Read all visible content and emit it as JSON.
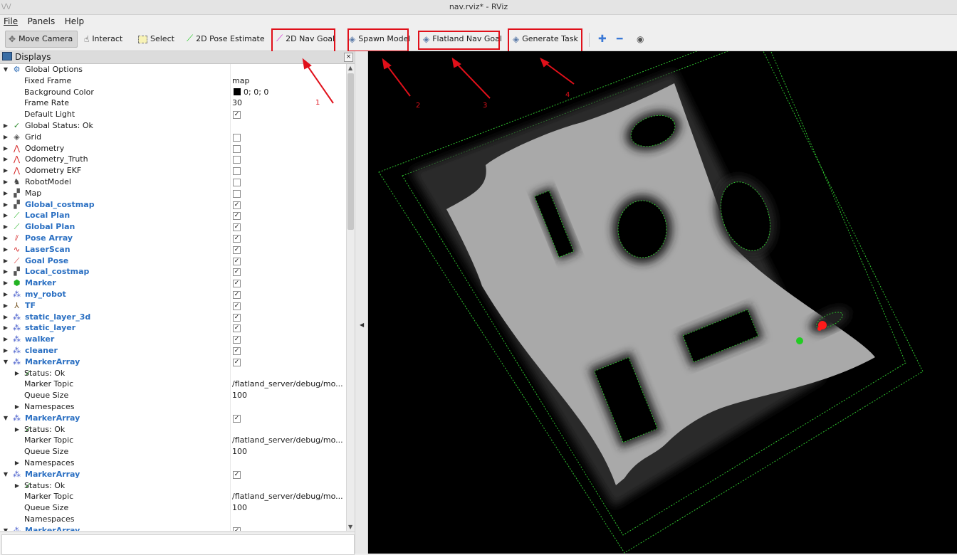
{
  "window": {
    "title": "nav.rviz* - RViz",
    "app_glyph": "\\/\\/"
  },
  "menu": {
    "items": [
      "File",
      "Panels",
      "Help"
    ]
  },
  "toolbar": {
    "move_camera": "Move Camera",
    "interact": "Interact",
    "select": "Select",
    "pose_estimate": "2D Pose Estimate",
    "nav_goal": "2D Nav Goal",
    "spawn_model": "Spawn Model",
    "flatland_nav_goal": "Flatland Nav Goal",
    "generate_task": "Generate Task"
  },
  "annotations": {
    "labels": [
      "1",
      "2",
      "3",
      "4"
    ],
    "color": "#e0101a"
  },
  "displays": {
    "title": "Displays",
    "rows": [
      {
        "indent": 0,
        "arrow": "down",
        "icon": "gear-icon",
        "name": "Global Options",
        "bold": false,
        "value": ""
      },
      {
        "indent": 1,
        "arrow": "",
        "icon": "",
        "name": "Fixed Frame",
        "bold": false,
        "value": "map"
      },
      {
        "indent": 1,
        "arrow": "",
        "icon": "",
        "name": "Background Color",
        "bold": false,
        "value": "0; 0; 0",
        "swatch": "#000000"
      },
      {
        "indent": 1,
        "arrow": "",
        "icon": "",
        "name": "Frame Rate",
        "bold": false,
        "value": "30"
      },
      {
        "indent": 1,
        "arrow": "",
        "icon": "",
        "name": "Default Light",
        "bold": false,
        "checkbox": true
      },
      {
        "indent": 0,
        "arrow": "right",
        "icon": "checkmark-icon",
        "name": "Global Status: Ok",
        "bold": false,
        "value": ""
      },
      {
        "indent": 0,
        "arrow": "right",
        "icon": "grid-icon",
        "name": "Grid",
        "bold": false,
        "checkbox": false
      },
      {
        "indent": 0,
        "arrow": "right",
        "icon": "odometry-icon",
        "name": "Odometry",
        "bold": false,
        "checkbox": false
      },
      {
        "indent": 0,
        "arrow": "right",
        "icon": "odometry-icon",
        "name": "Odometry_Truth",
        "bold": false,
        "checkbox": false
      },
      {
        "indent": 0,
        "arrow": "right",
        "icon": "odometry-icon",
        "name": "Odometry EKF",
        "bold": false,
        "checkbox": false
      },
      {
        "indent": 0,
        "arrow": "right",
        "icon": "robot-model-icon",
        "name": "RobotModel",
        "bold": false,
        "checkbox": false
      },
      {
        "indent": 0,
        "arrow": "right",
        "icon": "map-icon",
        "name": "Map",
        "bold": false,
        "checkbox": false
      },
      {
        "indent": 0,
        "arrow": "right",
        "icon": "map-icon",
        "name": "Global_costmap",
        "bold": true,
        "checkbox": true
      },
      {
        "indent": 0,
        "arrow": "right",
        "icon": "path-icon",
        "name": "Local Plan",
        "bold": true,
        "checkbox": true
      },
      {
        "indent": 0,
        "arrow": "right",
        "icon": "path-icon",
        "name": "Global Plan",
        "bold": true,
        "checkbox": true
      },
      {
        "indent": 0,
        "arrow": "right",
        "icon": "pose-array-icon",
        "name": "Pose Array",
        "bold": true,
        "checkbox": true
      },
      {
        "indent": 0,
        "arrow": "right",
        "icon": "laserscan-icon",
        "name": "LaserScan",
        "bold": true,
        "checkbox": true
      },
      {
        "indent": 0,
        "arrow": "right",
        "icon": "goal-pose-icon",
        "name": "Goal Pose",
        "bold": true,
        "checkbox": true
      },
      {
        "indent": 0,
        "arrow": "right",
        "icon": "local-costmap-icon",
        "name": "Local_costmap",
        "bold": true,
        "checkbox": true
      },
      {
        "indent": 0,
        "arrow": "right",
        "icon": "marker-icon",
        "name": "Marker",
        "bold": true,
        "checkbox": true
      },
      {
        "indent": 0,
        "arrow": "right",
        "icon": "marker-array-icon",
        "name": "my_robot",
        "bold": true,
        "checkbox": true
      },
      {
        "indent": 0,
        "arrow": "right",
        "icon": "tf-icon",
        "name": "TF",
        "bold": true,
        "checkbox": true
      },
      {
        "indent": 0,
        "arrow": "right",
        "icon": "marker-array-icon",
        "name": "static_layer_3d",
        "bold": true,
        "checkbox": true
      },
      {
        "indent": 0,
        "arrow": "right",
        "icon": "marker-array-icon",
        "name": "static_layer",
        "bold": true,
        "checkbox": true
      },
      {
        "indent": 0,
        "arrow": "right",
        "icon": "marker-array-icon",
        "name": "walker",
        "bold": true,
        "checkbox": true
      },
      {
        "indent": 0,
        "arrow": "right",
        "icon": "marker-array-icon",
        "name": "cleaner",
        "bold": true,
        "checkbox": true
      },
      {
        "indent": 0,
        "arrow": "down",
        "icon": "marker-array-icon",
        "name": "MarkerArray",
        "bold": true,
        "checkbox": true
      },
      {
        "indent": 1,
        "arrow": "right",
        "icon": "checkmark-icon",
        "name": "Status: Ok",
        "bold": false,
        "value": ""
      },
      {
        "indent": 1,
        "arrow": "",
        "icon": "",
        "name": "Marker Topic",
        "bold": false,
        "value": "/flatland_server/debug/mo..."
      },
      {
        "indent": 1,
        "arrow": "",
        "icon": "",
        "name": "Queue Size",
        "bold": false,
        "value": "100"
      },
      {
        "indent": 1,
        "arrow": "right",
        "icon": "",
        "name": "Namespaces",
        "bold": false,
        "value": ""
      },
      {
        "indent": 0,
        "arrow": "down",
        "icon": "marker-array-icon",
        "name": "MarkerArray",
        "bold": true,
        "checkbox": true
      },
      {
        "indent": 1,
        "arrow": "right",
        "icon": "checkmark-icon",
        "name": "Status: Ok",
        "bold": false,
        "value": ""
      },
      {
        "indent": 1,
        "arrow": "",
        "icon": "",
        "name": "Marker Topic",
        "bold": false,
        "value": "/flatland_server/debug/mo..."
      },
      {
        "indent": 1,
        "arrow": "",
        "icon": "",
        "name": "Queue Size",
        "bold": false,
        "value": "100"
      },
      {
        "indent": 1,
        "arrow": "right",
        "icon": "",
        "name": "Namespaces",
        "bold": false,
        "value": ""
      },
      {
        "indent": 0,
        "arrow": "down",
        "icon": "marker-array-icon",
        "name": "MarkerArray",
        "bold": true,
        "checkbox": true
      },
      {
        "indent": 1,
        "arrow": "right",
        "icon": "checkmark-icon",
        "name": "Status: Ok",
        "bold": false,
        "value": ""
      },
      {
        "indent": 1,
        "arrow": "",
        "icon": "",
        "name": "Marker Topic",
        "bold": false,
        "value": "/flatland_server/debug/mo..."
      },
      {
        "indent": 1,
        "arrow": "",
        "icon": "",
        "name": "Queue Size",
        "bold": false,
        "value": "100"
      },
      {
        "indent": 1,
        "arrow": "",
        "icon": "",
        "name": "Namespaces",
        "bold": false,
        "value": ""
      },
      {
        "indent": 0,
        "arrow": "down",
        "icon": "marker-array-icon",
        "name": "MarkerArray",
        "bold": true,
        "checkbox": true
      }
    ]
  },
  "colors": {
    "free_space": "#a9a9a9",
    "inflation": "#2b2b2b",
    "obstacle_outline": "#2ec12e",
    "robot": "#ff1a1a",
    "goal_marker": "#22cc22"
  }
}
